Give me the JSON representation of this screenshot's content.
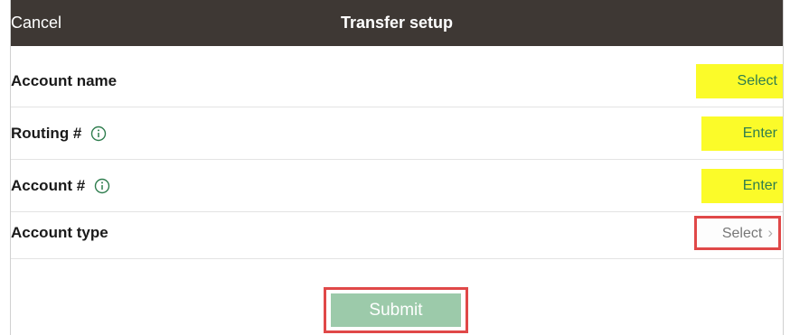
{
  "navbar": {
    "cancel_label": "Cancel",
    "title": "Transfer setup"
  },
  "form": {
    "rows": [
      {
        "label": "Account name",
        "value": "Select",
        "has_info": false
      },
      {
        "label": "Routing #",
        "value": "Enter",
        "has_info": true
      },
      {
        "label": "Account #",
        "value": "Enter",
        "has_info": true
      },
      {
        "label": "Account type",
        "value": "Select",
        "has_info": false
      }
    ]
  },
  "submit": {
    "label": "Submit"
  },
  "colors": {
    "navbar_bg": "#3e3834",
    "highlight_yellow": "#fbfb29",
    "value_text_green": "#2f7d4e",
    "outline_red": "#e04848",
    "submit_bg": "#9ccaaa"
  },
  "icons": {
    "info": "info-circle-icon",
    "chevron": "chevron-right-icon"
  }
}
